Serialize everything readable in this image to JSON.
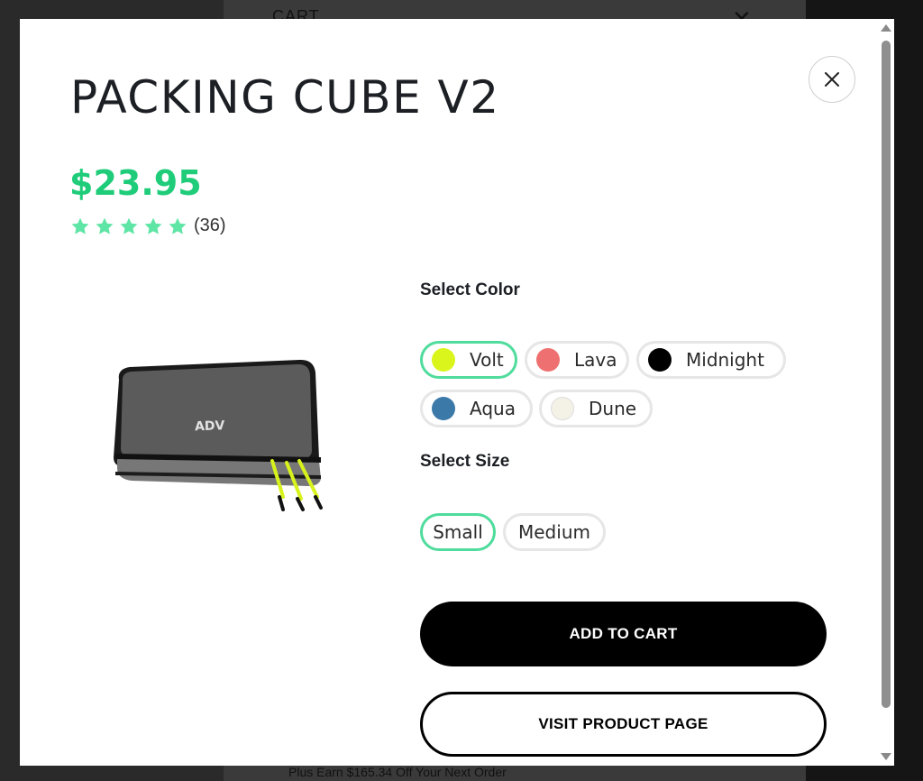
{
  "background": {
    "cart_title": "CART",
    "promo_text": "Plus Earn $165.34 Off Your Next Order"
  },
  "product": {
    "title": "PACKING CUBE V2",
    "price": "$23.95",
    "rating": 5,
    "review_count": "(36)",
    "image_logo": "ADV"
  },
  "color_section": {
    "label": "Select Color",
    "selected": "Volt",
    "options": [
      {
        "name": "Volt",
        "swatch": "#d9f51c"
      },
      {
        "name": "Lava",
        "swatch": "#ee7070"
      },
      {
        "name": "Midnight",
        "swatch": "#000000"
      },
      {
        "name": "Aqua",
        "swatch": "#3b79a8"
      },
      {
        "name": "Dune",
        "swatch": "#f4f1e6"
      }
    ]
  },
  "size_section": {
    "label": "Select Size",
    "selected": "Small",
    "options": [
      "Small",
      "Medium"
    ]
  },
  "buttons": {
    "add_to_cart": "ADD TO CART",
    "visit_product_page": "VISIT PRODUCT PAGE"
  },
  "colors": {
    "price": "#1fcc7a",
    "star": "#5fe5a5",
    "selected_border": "#4fdc9c"
  }
}
